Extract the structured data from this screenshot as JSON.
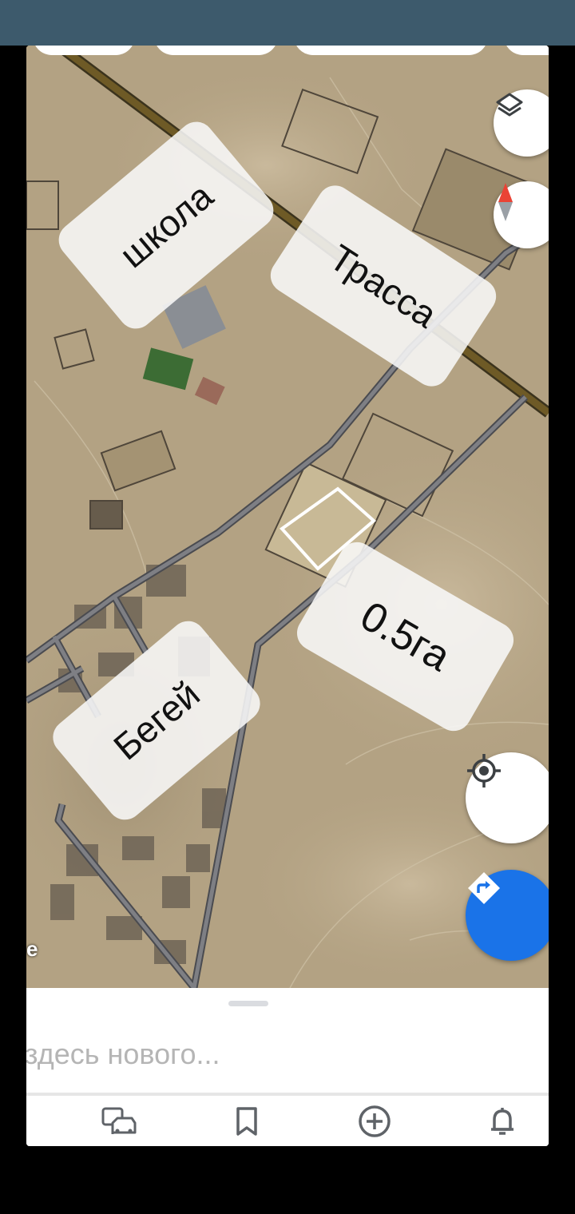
{
  "map": {
    "labels": {
      "school": "школа",
      "highway": "Трасса",
      "area": "0.5га",
      "village": "Бегей"
    },
    "attribution": "e"
  },
  "controls": {
    "layers_icon": "layers-icon",
    "compass_icon": "compass-icon",
    "locate_icon": "my-location-icon",
    "directions_icon": "directions-icon"
  },
  "sheet": {
    "text": "здесь нового..."
  },
  "nav": {
    "items": [
      "commute-icon",
      "saved-icon",
      "contribute-icon",
      "updates-icon"
    ]
  },
  "colors": {
    "status_bar": "#3d5a6c",
    "directions_button": "#1a73e8",
    "road": "#7e7f84",
    "highway": "#6e5a26"
  }
}
